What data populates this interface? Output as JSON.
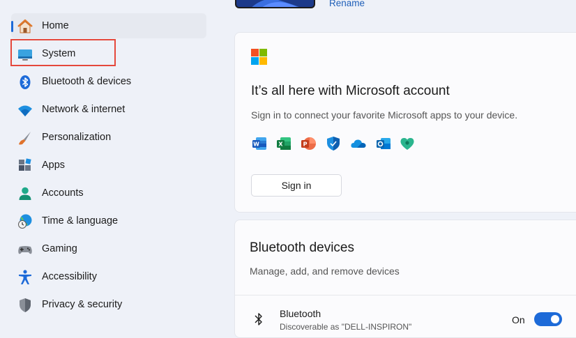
{
  "sidebar": {
    "items": [
      {
        "label": "Home",
        "icon": "home-icon"
      },
      {
        "label": "System",
        "icon": "system-monitor-icon"
      },
      {
        "label": "Bluetooth & devices",
        "icon": "bluetooth-icon"
      },
      {
        "label": "Network & internet",
        "icon": "wifi-icon"
      },
      {
        "label": "Personalization",
        "icon": "brush-icon"
      },
      {
        "label": "Apps",
        "icon": "apps-icon"
      },
      {
        "label": "Accounts",
        "icon": "person-icon"
      },
      {
        "label": "Time & language",
        "icon": "globe-clock-icon"
      },
      {
        "label": "Gaming",
        "icon": "gamepad-icon"
      },
      {
        "label": "Accessibility",
        "icon": "accessibility-icon"
      },
      {
        "label": "Privacy & security",
        "icon": "shield-icon"
      }
    ]
  },
  "device": {
    "rename_label": "Rename"
  },
  "microsoft_card": {
    "title": "It’s all here with Microsoft account",
    "subtitle": "Sign in to connect your favorite Microsoft apps to your device.",
    "apps": [
      "word-icon",
      "excel-icon",
      "powerpoint-icon",
      "defender-icon",
      "onedrive-icon",
      "outlook-icon",
      "family-icon"
    ],
    "signin_label": "Sign in"
  },
  "bluetooth_card": {
    "title": "Bluetooth devices",
    "subtitle": "Manage, add, and remove devices",
    "row_label": "Bluetooth",
    "row_sub": "Discoverable as \"DELL-INSPIRON\"",
    "toggle_state": "On"
  },
  "colors": {
    "accent": "#1d6ad8",
    "highlight_box": "#e5483c"
  }
}
